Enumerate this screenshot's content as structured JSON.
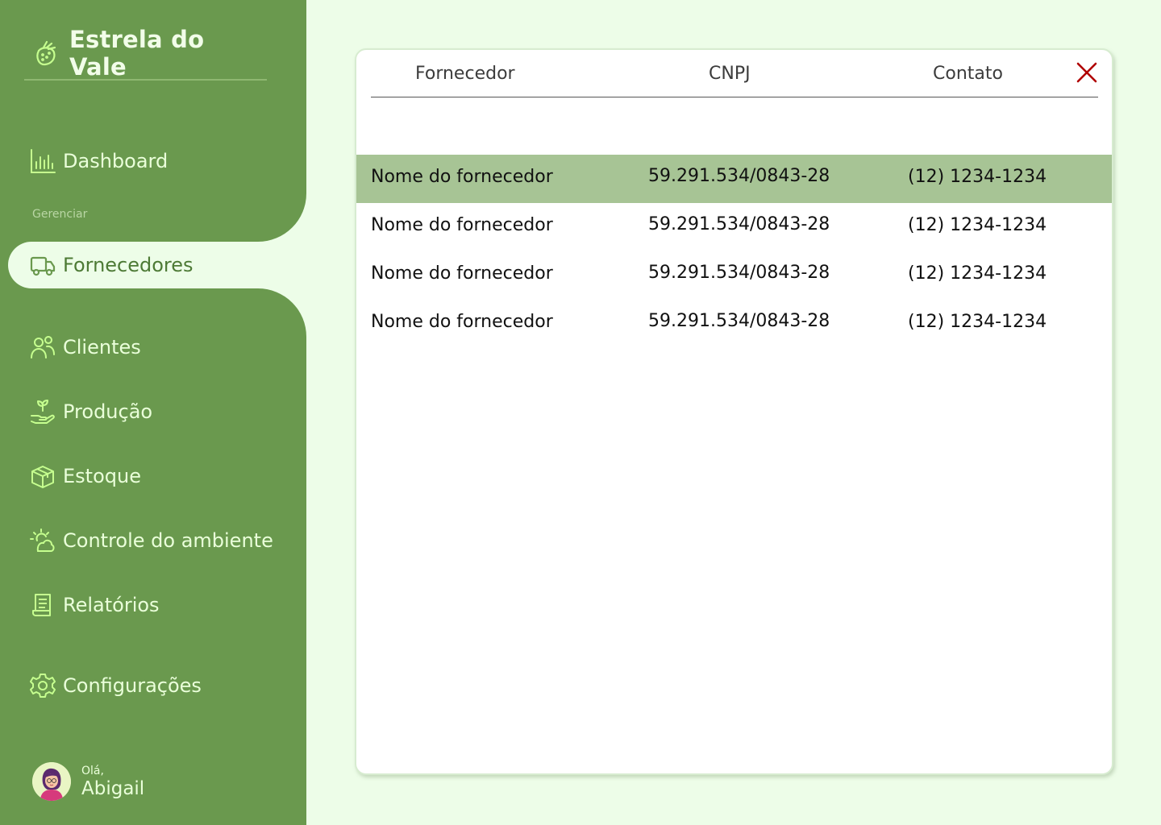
{
  "app": {
    "brand": "Estrela do Vale"
  },
  "sidebar": {
    "section_label": "Gerenciar",
    "items": [
      {
        "label": "Dashboard",
        "icon": "chart-icon"
      },
      {
        "label": "Fornecedores",
        "icon": "truck-icon",
        "active": true
      },
      {
        "label": "Clientes",
        "icon": "users-icon"
      },
      {
        "label": "Produção",
        "icon": "plant-hand-icon"
      },
      {
        "label": "Estoque",
        "icon": "box-icon"
      },
      {
        "label": "Controle do ambiente",
        "icon": "sun-cloud-icon"
      },
      {
        "label": "Relatórios",
        "icon": "report-icon"
      },
      {
        "label": "Configurações",
        "icon": "gear-icon"
      }
    ]
  },
  "user": {
    "greeting": "Olá,",
    "name": "Abigail"
  },
  "table": {
    "columns": [
      "Fornecedor",
      "CNPJ",
      "Contato"
    ],
    "rows": [
      {
        "fornecedor": "Nome do fornecedor",
        "cnpj": "59.291.534/0843-28",
        "contato": "(12) 1234-1234",
        "selected": true
      },
      {
        "fornecedor": "Nome do fornecedor",
        "cnpj": "59.291.534/0843-28",
        "contato": "(12) 1234-1234"
      },
      {
        "fornecedor": "Nome do fornecedor",
        "cnpj": "59.291.534/0843-28",
        "contato": "(12) 1234-1234"
      },
      {
        "fornecedor": "Nome do fornecedor",
        "cnpj": "59.291.534/0843-28",
        "contato": "(12) 1234-1234"
      }
    ]
  },
  "colors": {
    "sidebar": "#6a994e",
    "background": "#edfde8",
    "selected_row": "#a7c495",
    "close": "#b00000",
    "icon": "#c6ff8f"
  }
}
